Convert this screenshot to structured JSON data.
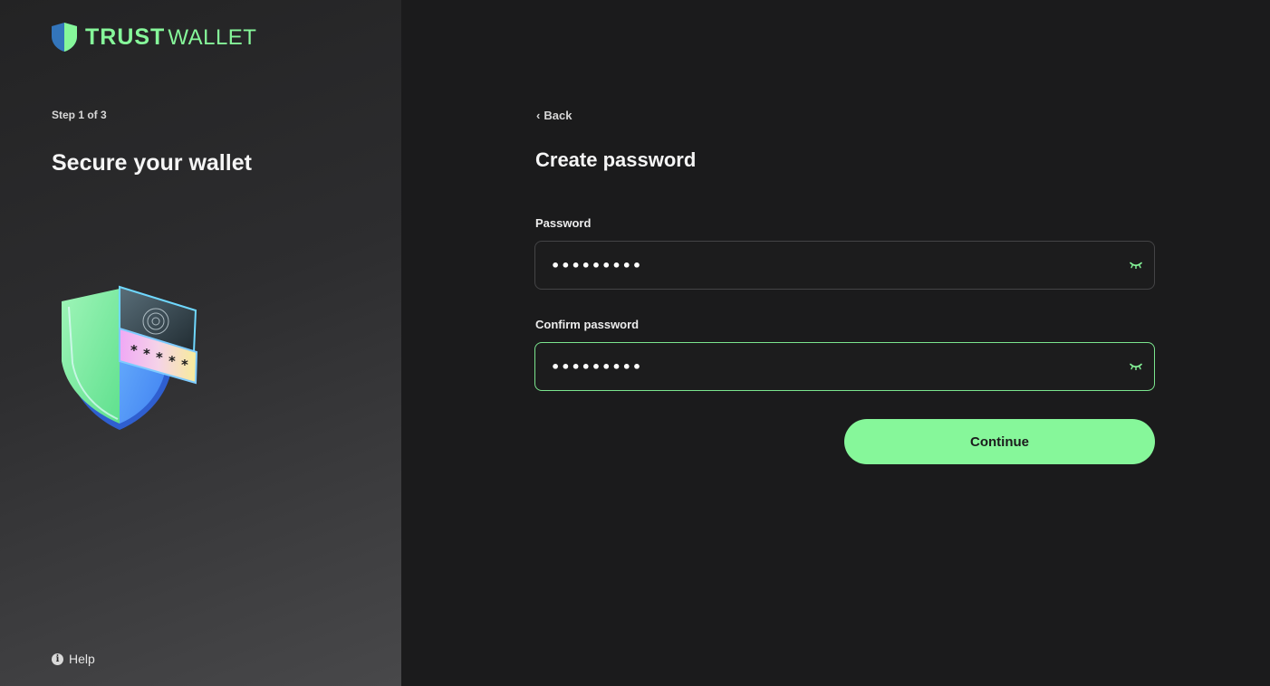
{
  "brand": {
    "name_bold": "TRUST",
    "name_light": "WALLET",
    "accent_color": "#86f79a",
    "icon": "shield-logo-icon"
  },
  "sidebar": {
    "step": "Step 1 of 3",
    "title": "Secure your wallet",
    "illustration_icon": "shield-password-illustration",
    "help_label": "Help",
    "help_icon": "info-icon"
  },
  "main": {
    "back_label": "Back",
    "back_icon": "chevron-left-icon",
    "title": "Create password",
    "password": {
      "label": "Password",
      "value": "•••••••••",
      "toggle_icon": "eye-closed-icon"
    },
    "confirm_password": {
      "label": "Confirm password",
      "value": "•••••••••",
      "toggle_icon": "eye-closed-icon",
      "focused": true
    },
    "continue_label": "Continue"
  }
}
